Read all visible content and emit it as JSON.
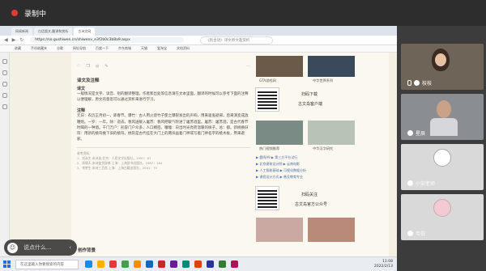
{
  "recorder": {
    "title": "录制中"
  },
  "browser": {
    "tabs": [
      "网易新闻",
      "白话版文,翻译和赏析",
      "古诗文网"
    ],
    "url": "https://so.gushiwen.cn/shiwenv_e3f2b0c3b8a9.aspx",
    "search_placeholder": "《别古语》译文原文及赏析",
    "bookmarks": [
      "收藏",
      "手机收藏夹",
      "谷歌",
      "网址导航",
      "百度一下",
      "京东商城",
      "天猫",
      "爱淘宝",
      "文档资料"
    ]
  },
  "article": {
    "notes_title": "译文及注释",
    "translation_title": "译文",
    "translation": "一般情况是文字、读音、别的翻译整理，作者和出处等信息请在文本里面，翻译的时候可以参考下面的注释以便理解，原文的意思可以通过赏析来进行学习。",
    "notes_heading": "注释",
    "notes": "元日：农历正月初一，即春节。爆竹：古人用火烧竹子使之爆裂发出的声响，用来驱鬼避邪，后来演变成放鞭炮。一岁：一年。除：逝去。春风送暖入屠苏：春风把暖气吹进了屠苏酒里。屠苏：屠苏酒，是古代春节时喝的一种酒。千门万户：形容门户众多，人口稠密。曈曈：日出时光亮而温暖的样子。总：都。新桃换旧符：用新的桃符换下旧的桃符。桃符是古代挂在大门上的两块画着门神或写着门神名字的桃木板，用来避邪。",
    "refs": [
      "参考资料：",
      "1、刘永生.宋诗选.北京：人民文学出版社，1997：67",
      "2、周啸天.宋诗鉴赏辞典.上海：上海辞书出版社，1987：184",
      "3、李梦生.宋诗三百首.上海：上海古籍出版社，2001：70"
    ],
    "creation_title": "创作背景"
  },
  "sidebar": {
    "captions": [
      "GTA游戏网",
      "中华世界系列",
      "热门视频推荐",
      "中华汉字研究"
    ],
    "download_title": "扫码下载",
    "download_subtitle": "古文岛客户端",
    "follow_title": "扫码关注",
    "follow_subtitle": "古文岛官方公众号",
    "links": [
      "▶ 鹿鸣A9  ▶ 第三方平台试行",
      "▶ 北京建筑设计院  ▶ 云南电影",
      "▶ 人工智能基础  ▶ 可视化数据分析",
      "▶ 课程设计方式  ▶ 普及教育专业"
    ]
  },
  "chat": {
    "placeholder": "说点什么..."
  },
  "taskbar": {
    "search_placeholder": "在这里输入你要搜索的内容",
    "time": "11:08",
    "date": "2022/2/13"
  },
  "participants": [
    {
      "name": "枝枝",
      "bg": "#6f6458"
    },
    {
      "name": "星辰",
      "bg": "#8a8e92"
    },
    {
      "name": "小安老师",
      "bg": "#d9d9d9"
    },
    {
      "name": "韦伯",
      "bg": "#d9d9d9"
    }
  ]
}
